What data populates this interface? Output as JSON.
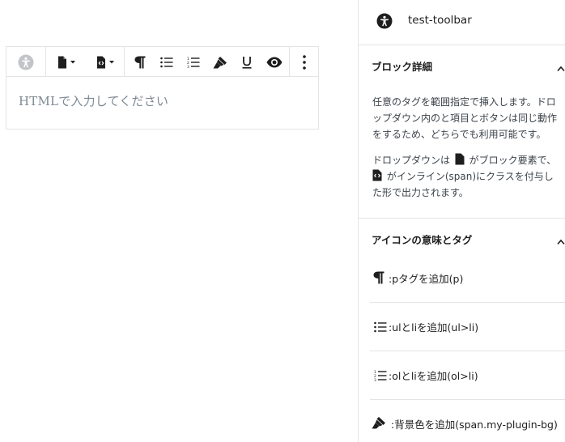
{
  "editor": {
    "placeholder": "HTMLで入力してください",
    "toolbar": [
      {
        "name": "accessibility-icon"
      },
      {
        "name": "block-document-dropdown"
      },
      {
        "name": "inline-code-dropdown"
      },
      {
        "name": "paragraph-icon"
      },
      {
        "name": "unordered-list-icon"
      },
      {
        "name": "ordered-list-icon"
      },
      {
        "name": "highlighter-icon"
      },
      {
        "name": "underline-icon"
      },
      {
        "name": "eye-icon"
      },
      {
        "name": "more-options-icon"
      }
    ]
  },
  "sidebar": {
    "plugin_title": "test-toolbar",
    "details": {
      "title": "ブロック詳細",
      "para1_lines": [
        "任意のタグを範囲指定で挿入します。ドロ",
        "ップダウン内のと項目とボタンは同じ動作",
        "をするため、どちらでも利用可能です。"
      ],
      "para2_line1_pre": "ドロップダウンは",
      "para2_line1_post": "がブロック要素で、",
      "para2_line2_post": "がインライン(span)にクラスを付与し",
      "para2_line3": "た形で出力されます。"
    },
    "legend": {
      "title": "アイコンの意味とタグ",
      "items": [
        {
          "icon": "paragraph-icon",
          "label": ":pタグを追加(p)"
        },
        {
          "icon": "unordered-list-icon",
          "label": ":ulとliを追加(ul>li)"
        },
        {
          "icon": "ordered-list-icon",
          "label": ":olとliを追加(ol>li)"
        },
        {
          "icon": "highlighter-icon",
          "label": ":背景色を追加(span.my-plugin-bg)"
        }
      ]
    }
  },
  "colors": {
    "border": "#e2e4e7",
    "text": "#1e1e1e",
    "muted_text": "#7e8993",
    "icon_disabled": "#a0a5aa"
  }
}
